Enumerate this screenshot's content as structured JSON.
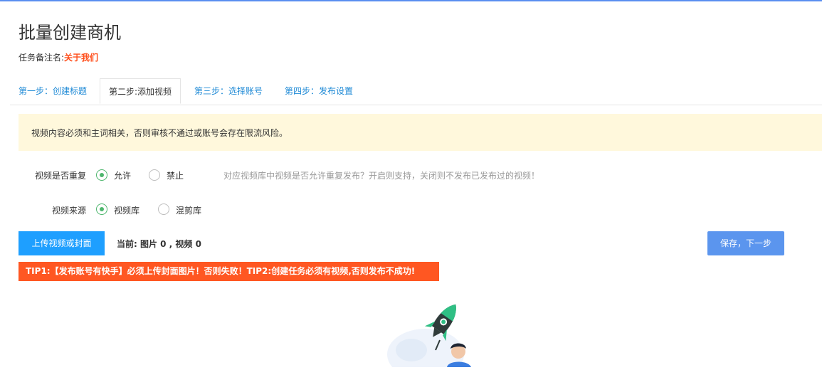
{
  "page": {
    "title": "批量创建商机",
    "remark_label": "任务备注名:",
    "remark_value": "关于我们"
  },
  "tabs": [
    {
      "label": "第一步：创建标题",
      "active": false
    },
    {
      "label": "第二步:添加视频",
      "active": true
    },
    {
      "label": "第三步：选择账号",
      "active": false
    },
    {
      "label": "第四步：发布设置",
      "active": false
    }
  ],
  "notice": "视频内容必须和主词相关，否则审核不通过或账号会存在限流风险。",
  "form": {
    "repeat": {
      "label": "视频是否重复",
      "options": [
        {
          "label": "允许",
          "checked": true
        },
        {
          "label": "禁止",
          "checked": false
        }
      ],
      "hint": "对应视频库中视频是否允许重复发布？开启则支持，关闭则不发布已发布过的视频！"
    },
    "source": {
      "label": "视频来源",
      "options": [
        {
          "label": "视频库",
          "checked": true
        },
        {
          "label": "混剪库",
          "checked": false
        }
      ]
    }
  },
  "actions": {
    "upload_label": "上传视频或封面",
    "current_text": "当前: 图片 0 , 视频 0",
    "save_label": "保存，下一步"
  },
  "tip": "TIP1:【发布账号有快手】必须上传封面图片！否则失败！TIP2:创建任务必须有视频,否则发布不成功!",
  "illustration": {
    "icon": "rocket-person-illustration"
  },
  "colors": {
    "accent_top": "#5a8ff0",
    "tab_link": "#1f8ad6",
    "remark_value": "#ff4d1a",
    "notice_bg": "#fff8dc",
    "radio_checked": "#4db66d",
    "upload_btn": "#1e9fff",
    "save_btn": "#5b95ee",
    "tip_bg": "#ff5722"
  }
}
